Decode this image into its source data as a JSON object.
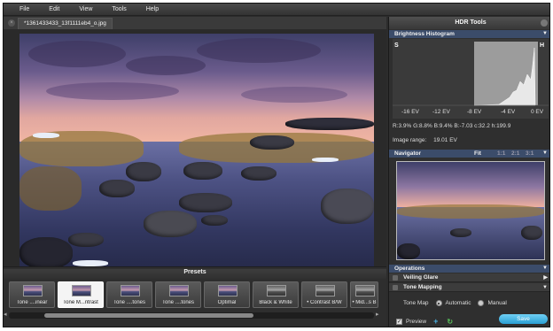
{
  "menu": [
    "File",
    "Edit",
    "View",
    "Tools",
    "Help"
  ],
  "tab": {
    "title": "*1361433433_13f1111eb4_o.jpg",
    "close": "×"
  },
  "presets": {
    "title": "Presets",
    "items": [
      {
        "label": "Tone ....inear",
        "active": false
      },
      {
        "label": "Tone M...ntrast",
        "active": true
      },
      {
        "label": "Tone ....tones",
        "active": false
      },
      {
        "label": "Tone ....tones",
        "active": false
      },
      {
        "label": "Optimal",
        "active": false
      },
      {
        "label": "Black & White",
        "active": false
      },
      {
        "label": "• Contrast B/W",
        "active": false
      },
      {
        "label": "• Mid...s B",
        "active": false
      }
    ]
  },
  "panel": {
    "title": "HDR Tools",
    "histogram": {
      "title": "Brightness Histogram",
      "s_label": "S",
      "h_label": "H",
      "ev_ticks": [
        "-16 EV",
        "-12 EV",
        "-8 EV",
        "-4 EV",
        "0 EV"
      ],
      "stats": "R:3.9%   G:8.8%   B:9.4%       B:-7.03   c:32.2     h:199.9",
      "image_range_label": "Image range:",
      "image_range_value": "19.01 EV"
    },
    "navigator": {
      "title": "Navigator",
      "fit": "Fit",
      "zooms": [
        "1:1",
        "2:1",
        "3:1"
      ]
    },
    "operations": {
      "title": "Operations",
      "items": [
        "Veiling Glare",
        "Tone Mapping"
      ],
      "tone_map_label": "Tone Map",
      "automatic": "Automatic",
      "manual": "Manual"
    },
    "preview_label": "Preview",
    "add_icon": "+",
    "refresh_icon": "↻",
    "save_label": "Save"
  }
}
